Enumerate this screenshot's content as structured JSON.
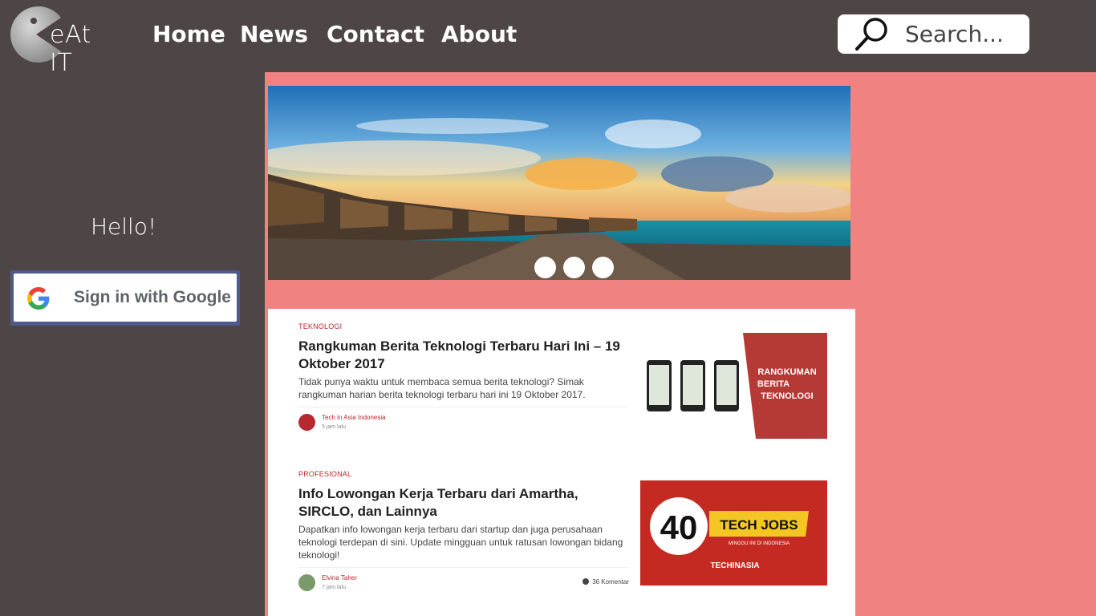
{
  "header": {
    "logo_text": "eAt IT",
    "nav": [
      {
        "label": "Home"
      },
      {
        "label": "News"
      },
      {
        "label": "Contact"
      },
      {
        "label": "About"
      }
    ],
    "search_placeholder": "Search..."
  },
  "sidebar": {
    "greeting": "Hello!",
    "google_button_label": "Sign in with Google"
  },
  "slider": {
    "dot_count": 3
  },
  "articles": [
    {
      "category": "TEKNOLOGI",
      "title": "Rangkuman Berita Teknologi Terbaru Hari Ini – 19 Oktober 2017",
      "description": "Tidak punya waktu untuk membaca semua berita teknologi? Simak rangkuman harian berita teknologi terbaru hari ini 19 Oktober 2017.",
      "author": "Tech in Asia Indonesia",
      "time": "5 jam lalu",
      "thumb_text": [
        "RANGKUMAN",
        "BERITA",
        "TEKNOLOGI"
      ]
    },
    {
      "category": "PROFESIONAL",
      "title": "Info Lowongan Kerja Terbaru dari Amartha, SIRCLO, dan Lainnya",
      "description": "Dapatkan info lowongan kerja terbaru dari startup dan juga perusahaan teknologi terdepan di sini. Update mingguan untuk ratusan lowongan bidang teknologi!",
      "author": "Elvina Taher",
      "time": "7 jam lalu",
      "comments": "36 Komentar",
      "thumb_text": [
        "40",
        "TECH JOBS",
        "MINGGU INI DI INDONESIA",
        "TECHINASIA"
      ]
    }
  ],
  "colors": {
    "background": "#4e4546",
    "main": "#f08281",
    "accent": "#b8282f"
  }
}
